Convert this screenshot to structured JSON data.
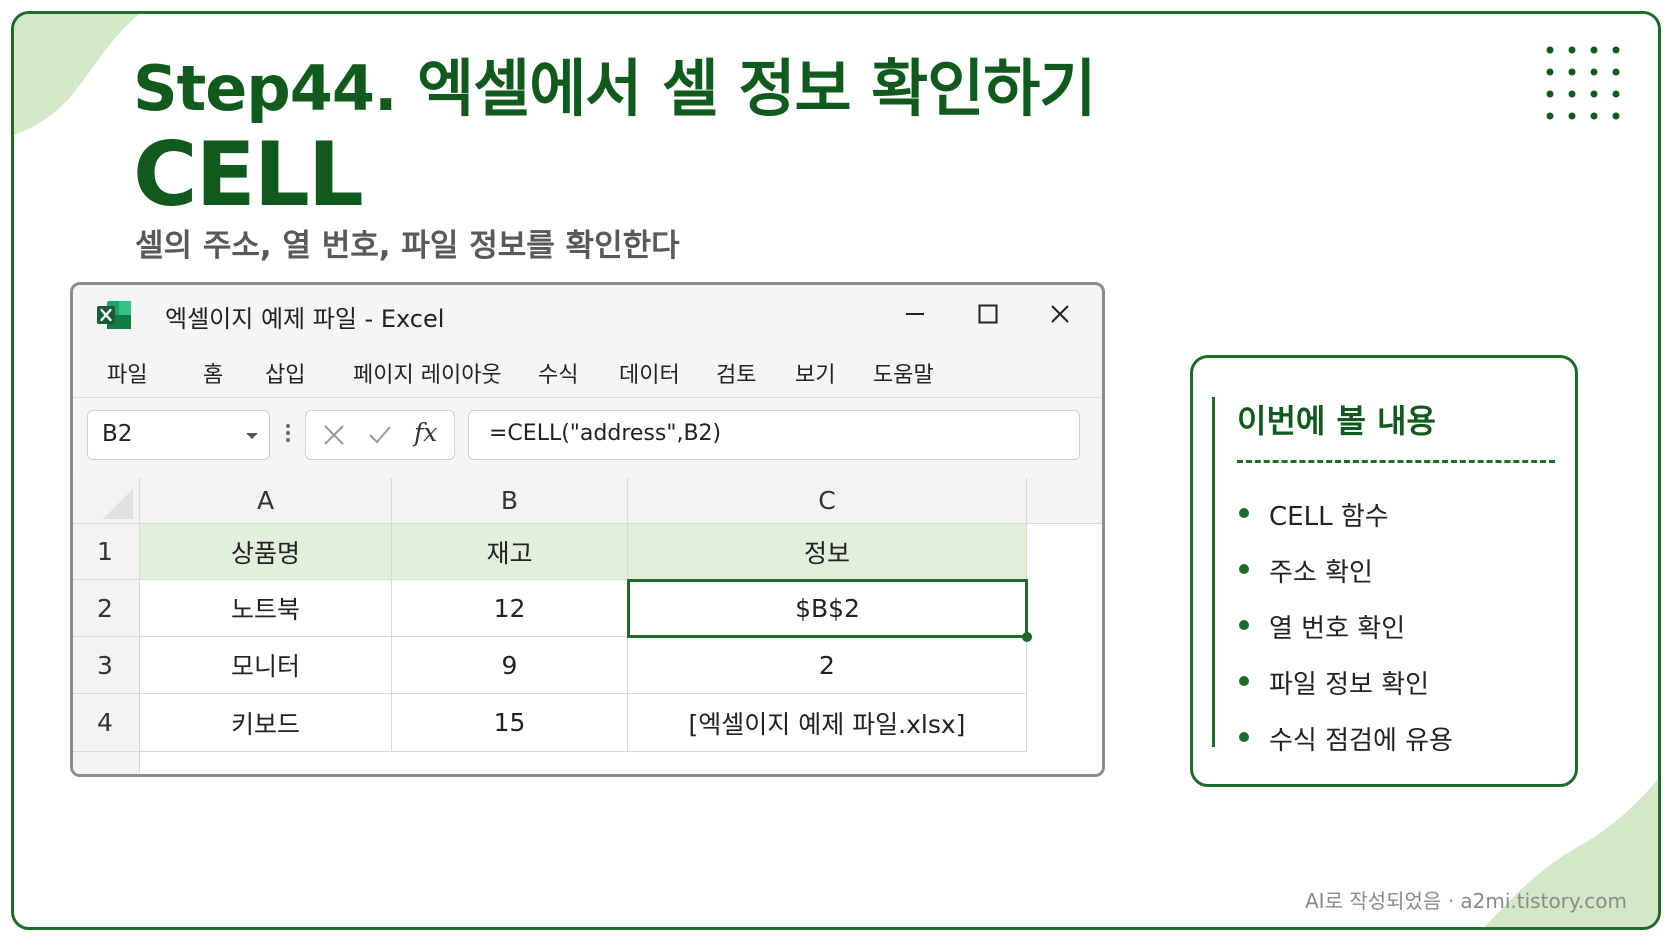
{
  "slide": {
    "title": "Step44. 엑셀에서 셀 정보 확인하기",
    "function_name": "CELL",
    "subtitle": "셀의 주소, 열 번호, 파일 정보를 확인한다",
    "footer": "AI로 작성되었음 · a2mi.tistory.com"
  },
  "excel": {
    "window_title": "엑셀이지 예제 파일  -  Excel",
    "ribbon_tabs": [
      "파일",
      "홈",
      "삽입",
      "페이지 레이아웃",
      "수식",
      "데이터",
      "검토",
      "보기",
      "도움말"
    ],
    "name_box": "B2",
    "fx_label": "fx",
    "formula": "=CELL(\"address\",B2)",
    "columns": [
      "A",
      "B",
      "C"
    ],
    "row_numbers": [
      "1",
      "2",
      "3",
      "4"
    ],
    "rows": [
      [
        "상품명",
        "재고",
        "정보"
      ],
      [
        "노트북",
        "12",
        "$B$2"
      ],
      [
        "모니터",
        "9",
        "2"
      ],
      [
        "키보드",
        "15",
        "[엑셀이지 예제 파일.xlsx]"
      ]
    ]
  },
  "panel": {
    "title": "이번에 볼 내용",
    "items": [
      "CELL 함수",
      "주소 확인",
      "열 번호 확인",
      "파일 정보 확인",
      "수식 점검에 유용"
    ]
  },
  "colors": {
    "brand_green": "#1e6b2a",
    "title_green": "#0f5a1c",
    "header_fill": "#e2efda",
    "blob": "#d3e8c8"
  }
}
